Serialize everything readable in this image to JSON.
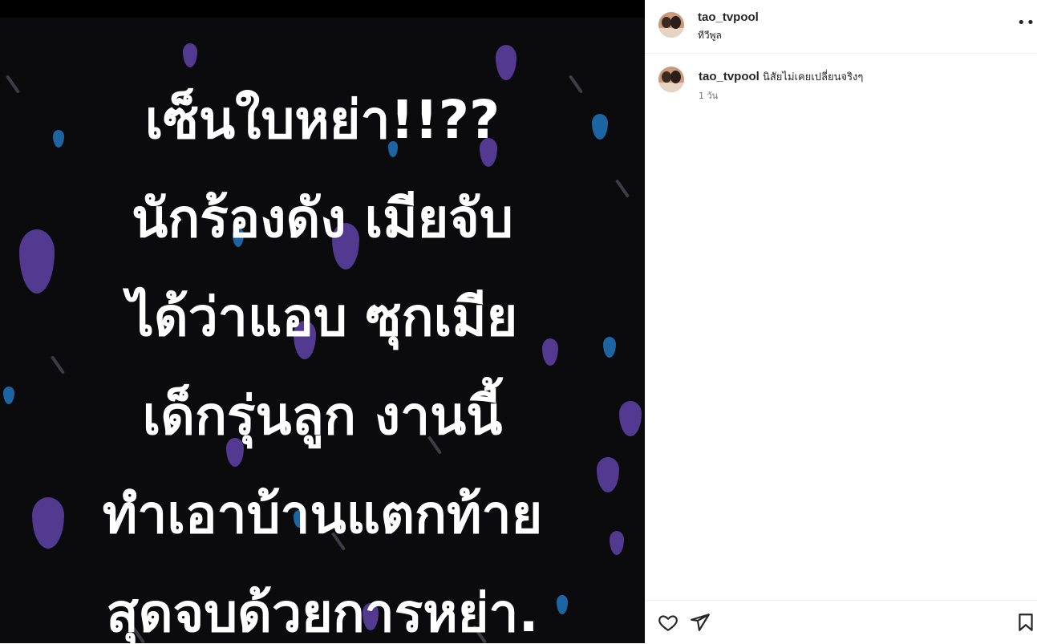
{
  "post": {
    "image_text_lines": [
      "เซ็นใบหย่า!!??",
      "นักร้องดัง เมียจับ",
      "ได้ว่าแอบ ซุกเมีย",
      "เด็กรุ่นลูก งานนี้",
      "ทำเอาบ้านแตกท้าย",
      "สุดจบด้วยการหย่า."
    ]
  },
  "header": {
    "username": "tao_tvpool",
    "location": "ทีวีพูล",
    "more_icon": "more-options-icon"
  },
  "caption": {
    "username": "tao_tvpool",
    "text": "นิสัยไม่เคยเปลี่ยนจริงๆ",
    "time": "1 วัน"
  },
  "actions": {
    "like_icon": "heart-icon",
    "share_icon": "send-icon",
    "save_icon": "bookmark-icon"
  },
  "colors": {
    "drop_blue": "#1f6fb2",
    "drop_purple": "#5a3f9e",
    "text_primary": "#262626",
    "text_secondary": "#737373"
  }
}
